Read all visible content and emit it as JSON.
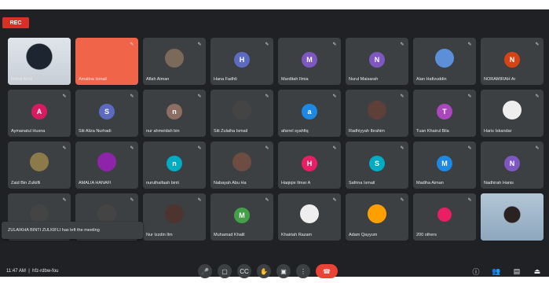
{
  "recording": {
    "label": "REC"
  },
  "toast": {
    "text": "ZULAIKHA BINTI ZULKIFLI has left the meeting"
  },
  "bottom": {
    "time": "11:47 AM",
    "meeting": "hfz-rdbw-fou"
  },
  "participants": [
    {
      "name": "Rohai Armi",
      "avatar": "",
      "color": "",
      "kind": "self"
    },
    {
      "name": "Amalina Ismail",
      "avatar": "",
      "color": "#f0644a",
      "kind": "orange"
    },
    {
      "name": "Aflah Aiman",
      "avatar": "",
      "color": "#7b6a5a",
      "kind": "img"
    },
    {
      "name": "Hana Fadhli",
      "avatar": "H",
      "color": "#5c6bc0",
      "kind": "letter"
    },
    {
      "name": "Marditah Ilmia",
      "avatar": "M",
      "color": "#7e57c2",
      "kind": "letter"
    },
    {
      "name": "Nurul Maisarah",
      "avatar": "N",
      "color": "#7e57c2",
      "kind": "letter"
    },
    {
      "name": "Alan Hafizuddin",
      "avatar": "",
      "color": "#5b8fd8",
      "kind": "img"
    },
    {
      "name": "NORAMIRAH Ar",
      "avatar": "N",
      "color": "#d84315",
      "kind": "letter"
    },
    {
      "name": "Aymanatul Husna",
      "avatar": "A",
      "color": "#d81b60",
      "kind": "letter"
    },
    {
      "name": "Siti Aliza Nurhadi",
      "avatar": "S",
      "color": "#5c6bc0",
      "kind": "letter"
    },
    {
      "name": "nur ahmeidah bin",
      "avatar": "n",
      "color": "#8d6e63",
      "kind": "letter"
    },
    {
      "name": "Siti Zulaiha Ismail",
      "avatar": "",
      "color": "#444",
      "kind": "img"
    },
    {
      "name": "afarrel syahfiq",
      "avatar": "a",
      "color": "#1e88e5",
      "kind": "letter"
    },
    {
      "name": "Radhiyyah Ibrahim",
      "avatar": "",
      "color": "#5d4037",
      "kind": "img"
    },
    {
      "name": "Tuan Khairul Bila",
      "avatar": "T",
      "color": "#ab47bc",
      "kind": "letter"
    },
    {
      "name": "Haris Iskandar",
      "avatar": "",
      "color": "#eeeeee",
      "kind": "img"
    },
    {
      "name": "Zaid Bin Zulkifli",
      "avatar": "",
      "color": "#8d7a4a",
      "kind": "img"
    },
    {
      "name": "AMALIA HANAFI",
      "avatar": "",
      "color": "#8e24aa",
      "kind": "img"
    },
    {
      "name": "nurulhaifaah binti",
      "avatar": "n",
      "color": "#00acc1",
      "kind": "letter"
    },
    {
      "name": "Nabayah Abu Ha",
      "avatar": "",
      "color": "#6d4c41",
      "kind": "img"
    },
    {
      "name": "Haqiqie Ilmar A",
      "avatar": "H",
      "color": "#e91e63",
      "kind": "letter"
    },
    {
      "name": "Safrina Ismail",
      "avatar": "S",
      "color": "#00acc1",
      "kind": "letter"
    },
    {
      "name": "Madiha Aiman",
      "avatar": "M",
      "color": "#1e88e5",
      "kind": "letter"
    },
    {
      "name": "Nadhirah Hanis",
      "avatar": "N",
      "color": "#7e57c2",
      "kind": "letter"
    },
    {
      "name": "Farhanah Mohd",
      "avatar": "",
      "color": "#444",
      "kind": "img"
    },
    {
      "name": "palidia susanka",
      "avatar": "",
      "color": "#444",
      "kind": "img"
    },
    {
      "name": "Nur Izzdin Ilm",
      "avatar": "",
      "color": "#4e342e",
      "kind": "img"
    },
    {
      "name": "Muhamad Khalil",
      "avatar": "M",
      "color": "#43a047",
      "kind": "letter"
    },
    {
      "name": "Khairiah Razam",
      "avatar": "",
      "color": "#eeeeee",
      "kind": "img"
    },
    {
      "name": "Adam Qayyum",
      "avatar": "",
      "color": "#ffa000",
      "kind": "img"
    },
    {
      "name": "200 others",
      "avatar": "",
      "color": "#e91e63",
      "kind": "others"
    },
    {
      "name": "",
      "avatar": "",
      "color": "",
      "kind": "photo"
    }
  ]
}
